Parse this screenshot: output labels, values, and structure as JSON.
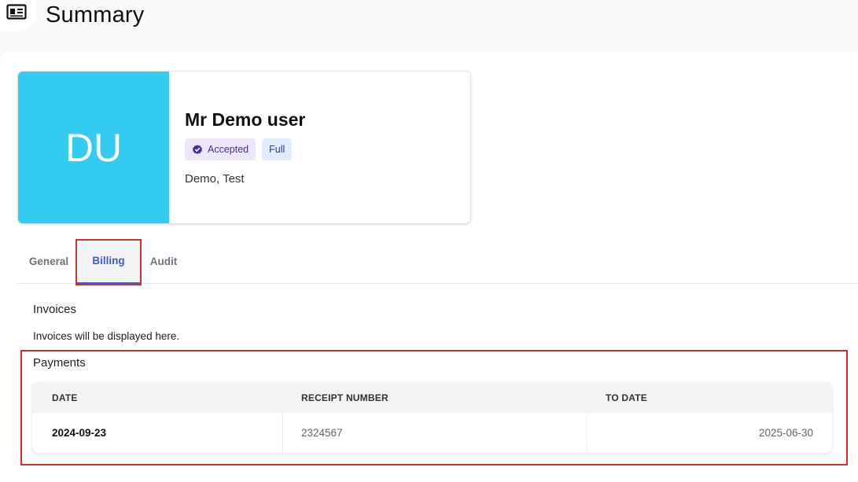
{
  "header": {
    "title": "Summary",
    "icon": "id-card-icon"
  },
  "profile": {
    "initials": "DU",
    "avatar_color": "#33ccf0",
    "name": "Mr Demo user",
    "badges": [
      {
        "label": "Accepted",
        "icon": "verified-check-icon",
        "color": "#4b2aa6"
      },
      {
        "label": "Full",
        "color": "#203d8a"
      }
    ],
    "meta": "Demo, Test"
  },
  "tabs": [
    {
      "label": "General",
      "active": false
    },
    {
      "label": "Billing",
      "active": true
    },
    {
      "label": "Audit",
      "active": false
    }
  ],
  "invoices": {
    "title": "Invoices",
    "note": "Invoices will be displayed here."
  },
  "payments": {
    "title": "Payments",
    "columns": [
      "DATE",
      "RECEIPT NUMBER",
      "TO DATE"
    ],
    "rows": [
      {
        "date": "2024-09-23",
        "receipt": "2324567",
        "to_date": "2025-06-30"
      }
    ]
  },
  "colors": {
    "accent": "#3b5bdb",
    "highlight": "#d32f2f"
  }
}
